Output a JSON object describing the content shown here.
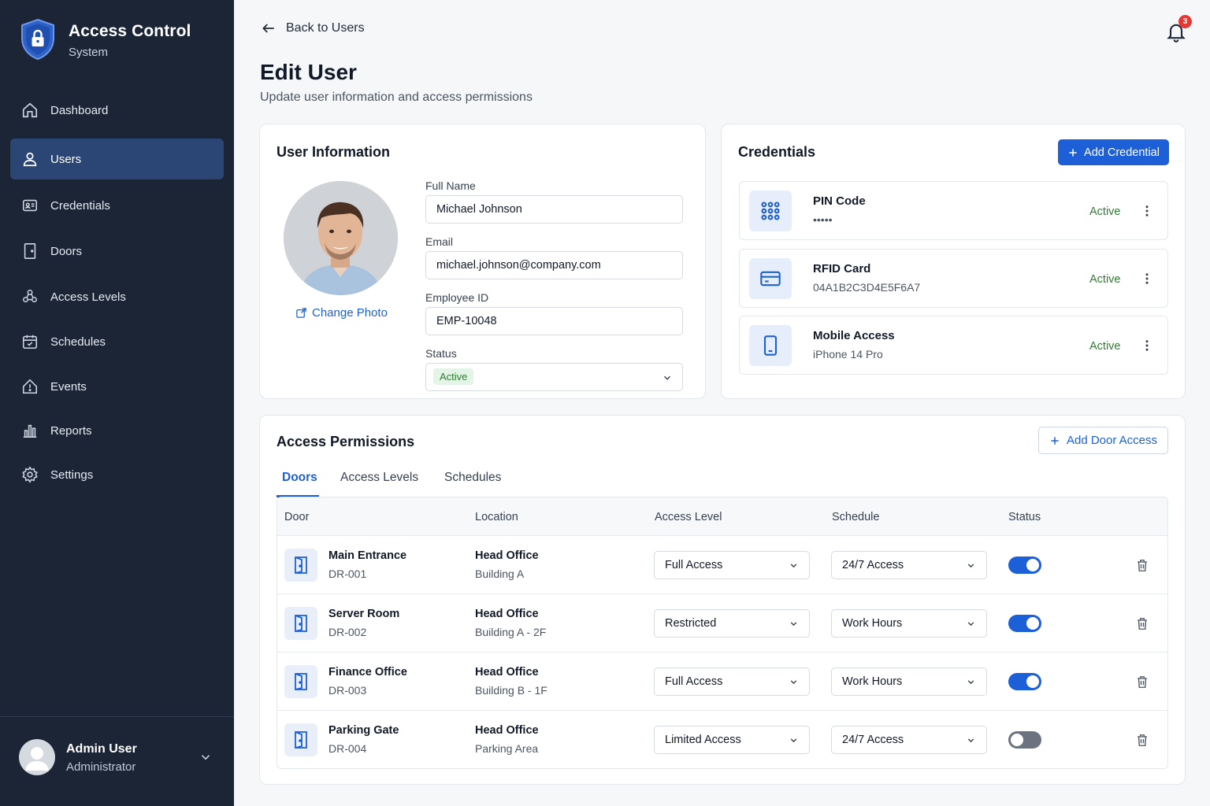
{
  "brand": {
    "title": "Access Control",
    "subtitle": "System",
    "logo_icon": "shield-lock-icon"
  },
  "sidebar": {
    "items": [
      {
        "label": "Dashboard",
        "icon": "home-icon",
        "active": false
      },
      {
        "label": "Users",
        "icon": "user-icon",
        "active": true
      },
      {
        "label": "Credentials",
        "icon": "credential-card-icon",
        "active": false
      },
      {
        "label": "Doors",
        "icon": "door-icon",
        "active": false
      },
      {
        "label": "Access Levels",
        "icon": "access-levels-icon",
        "active": false
      },
      {
        "label": "Schedules",
        "icon": "calendar-icon",
        "active": false
      },
      {
        "label": "Events",
        "icon": "events-icon",
        "active": false
      },
      {
        "label": "Reports",
        "icon": "bar-chart-icon",
        "active": false
      },
      {
        "label": "Settings",
        "icon": "gear-icon",
        "active": false
      }
    ],
    "user": {
      "name": "Admin User",
      "role": "Administrator"
    }
  },
  "header": {
    "back_label": "Back to Users",
    "notification_count": "3"
  },
  "page": {
    "title": "Edit User",
    "subtitle": "Update user information and access permissions"
  },
  "user_info": {
    "title": "User Information",
    "change_photo_label": "Change Photo",
    "fields": {
      "full_name": {
        "label": "Full Name",
        "value": "Michael Johnson"
      },
      "email": {
        "label": "Email",
        "value": "michael.johnson@company.com"
      },
      "employee_id": {
        "label": "Employee ID",
        "value": "EMP-10048"
      },
      "status": {
        "label": "Status",
        "value": "Active"
      }
    }
  },
  "credentials": {
    "title": "Credentials",
    "add_label": "Add Credential",
    "items": [
      {
        "name": "PIN Code",
        "value": "•••••",
        "status": "Active",
        "icon": "keypad-icon"
      },
      {
        "name": "RFID Card",
        "value": "04A1B2C3D4E5F6A7",
        "status": "Active",
        "icon": "card-icon"
      },
      {
        "name": "Mobile Access",
        "value": "iPhone 14 Pro",
        "status": "Active",
        "icon": "mobile-icon"
      }
    ]
  },
  "permissions": {
    "title": "Access Permissions",
    "add_label": "Add Door Access",
    "tabs": [
      {
        "label": "Doors",
        "active": true
      },
      {
        "label": "Access Levels",
        "active": false
      },
      {
        "label": "Schedules",
        "active": false
      }
    ],
    "columns": [
      "Door",
      "Location",
      "Access Level",
      "Schedule",
      "Status"
    ],
    "rows": [
      {
        "door": "Main Entrance",
        "id": "DR-001",
        "loc1": "Head Office",
        "loc2": "Building A",
        "level": "Full Access",
        "schedule": "24/7 Access",
        "enabled": true
      },
      {
        "door": "Server Room",
        "id": "DR-002",
        "loc1": "Head Office",
        "loc2": "Building A - 2F",
        "level": "Restricted",
        "schedule": "Work Hours",
        "enabled": true
      },
      {
        "door": "Finance Office",
        "id": "DR-003",
        "loc1": "Head Office",
        "loc2": "Building B - 1F",
        "level": "Full Access",
        "schedule": "Work Hours",
        "enabled": true
      },
      {
        "door": "Parking Gate",
        "id": "DR-004",
        "loc1": "Head Office",
        "loc2": "Parking Area",
        "level": "Limited Access",
        "schedule": "24/7 Access",
        "enabled": false
      }
    ]
  },
  "colors": {
    "sidebar_bg": "#1b2536",
    "active_nav": "#2b4674",
    "accent": "#1d5fd6",
    "success": "#2e7d32",
    "badge": "#e53935"
  }
}
